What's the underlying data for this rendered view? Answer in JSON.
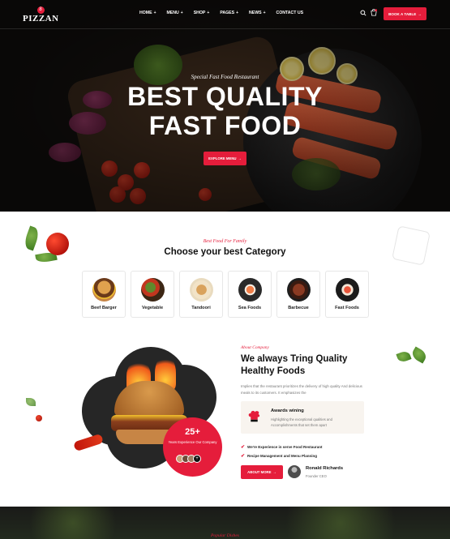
{
  "brand": {
    "name": "PIZZAN",
    "badge": "8"
  },
  "nav": {
    "items": [
      {
        "label": "HOME",
        "suffix": "+"
      },
      {
        "label": "MENU",
        "suffix": "+"
      },
      {
        "label": "SHOP",
        "suffix": "+"
      },
      {
        "label": "PAGES",
        "suffix": "+"
      },
      {
        "label": "NEWS",
        "suffix": "+"
      },
      {
        "label": "CONTACT US",
        "suffix": ""
      }
    ],
    "book_label": "BOOK A TABLE",
    "book_arrow": "→"
  },
  "hero": {
    "subtitle": "Special Fast Food Restaurant",
    "title_line1": "BEST QUALITY",
    "title_line2": "FAST FOOD",
    "button_label": "EXPLORE MENU",
    "button_arrow": "→"
  },
  "category": {
    "subtitle": "Best Food For Family",
    "title": "Choose your best Category",
    "items": [
      {
        "label": "Beef Barger"
      },
      {
        "label": "Vegetable"
      },
      {
        "label": "Tandoori"
      },
      {
        "label": "Sea Foods"
      },
      {
        "label": "Barbecue"
      },
      {
        "label": "Fast Foods"
      }
    ]
  },
  "about": {
    "subtitle": "About Company",
    "title": "We always Tring Quality Healthy Foods",
    "text": "Implies that the restaurant prioritizes the delivery of high quality And delicious meals to its customers. It emphasizes the",
    "years_number": "25+",
    "years_text": "Years Experience Our Company",
    "avatars_plus": "+",
    "award": {
      "title": "Awards wining",
      "text": "Highlighting the exceptional qualities and Accomplishments that set them apart"
    },
    "checks": [
      "We're Experience in serve Food Restaurant",
      "Recipe Management and Menu Planning"
    ],
    "button_label": "ABOUT MORE",
    "button_arrow": "→",
    "founder_name": "Ronald Richards",
    "founder_role": "Founder CEO"
  },
  "bottom": {
    "subtitle": "Popular Dishes"
  },
  "colors": {
    "accent": "#e51d3b",
    "dark": "#14110f",
    "award_bg": "#f8f4ef"
  }
}
